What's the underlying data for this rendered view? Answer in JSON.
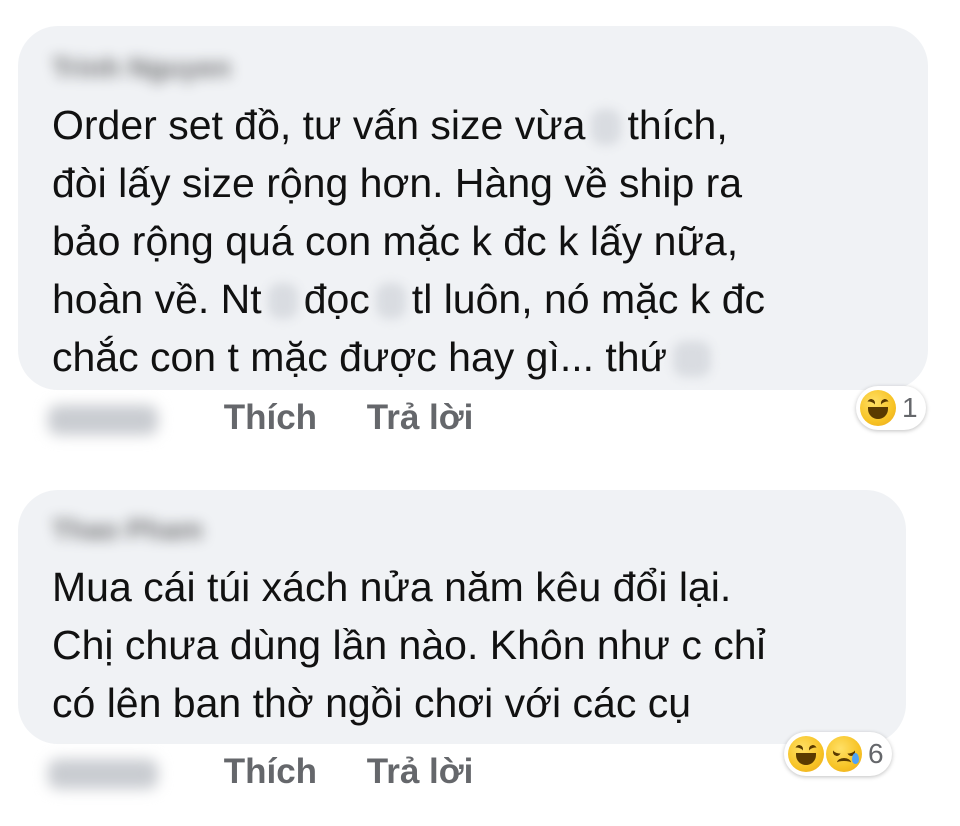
{
  "comments": [
    {
      "author": "Trinh Nguyen",
      "text_lines": [
        {
          "before": "Order set đồ, tư vấn size vừa",
          "after": "thích,"
        },
        {
          "before": "đòi lấy size rộng hơn. Hàng về ship ra"
        },
        {
          "before": "bảo rộng quá con mặc k đc k lấy nữa,"
        },
        {
          "before": "hoàn về. Nt",
          "mid": "đọc",
          "after": "tl luôn, nó mặc k đc"
        },
        {
          "before": "chắc con t mặc được hay gì... thứ"
        }
      ],
      "actions": {
        "like": "Thích",
        "reply": "Trả lời"
      },
      "reactions": {
        "icons": [
          "haha-emoji"
        ],
        "count": "1"
      }
    },
    {
      "author": "Thao Pham",
      "text_lines": [
        {
          "before": "Mua cái túi xách nửa năm kêu đổi lại."
        },
        {
          "before": "Chị chưa dùng lần nào. Khôn như c chỉ"
        },
        {
          "before": "có lên ban thờ ngồi chơi với các cụ"
        }
      ],
      "actions": {
        "like": "Thích",
        "reply": "Trả lời"
      },
      "reactions": {
        "icons": [
          "haha-emoji",
          "sad-emoji"
        ],
        "count": "6"
      }
    }
  ],
  "colors": {
    "bubble": "#f0f2f5",
    "text": "#111111",
    "action_text": "#65676b",
    "reaction_emoji": "#f7c325"
  }
}
